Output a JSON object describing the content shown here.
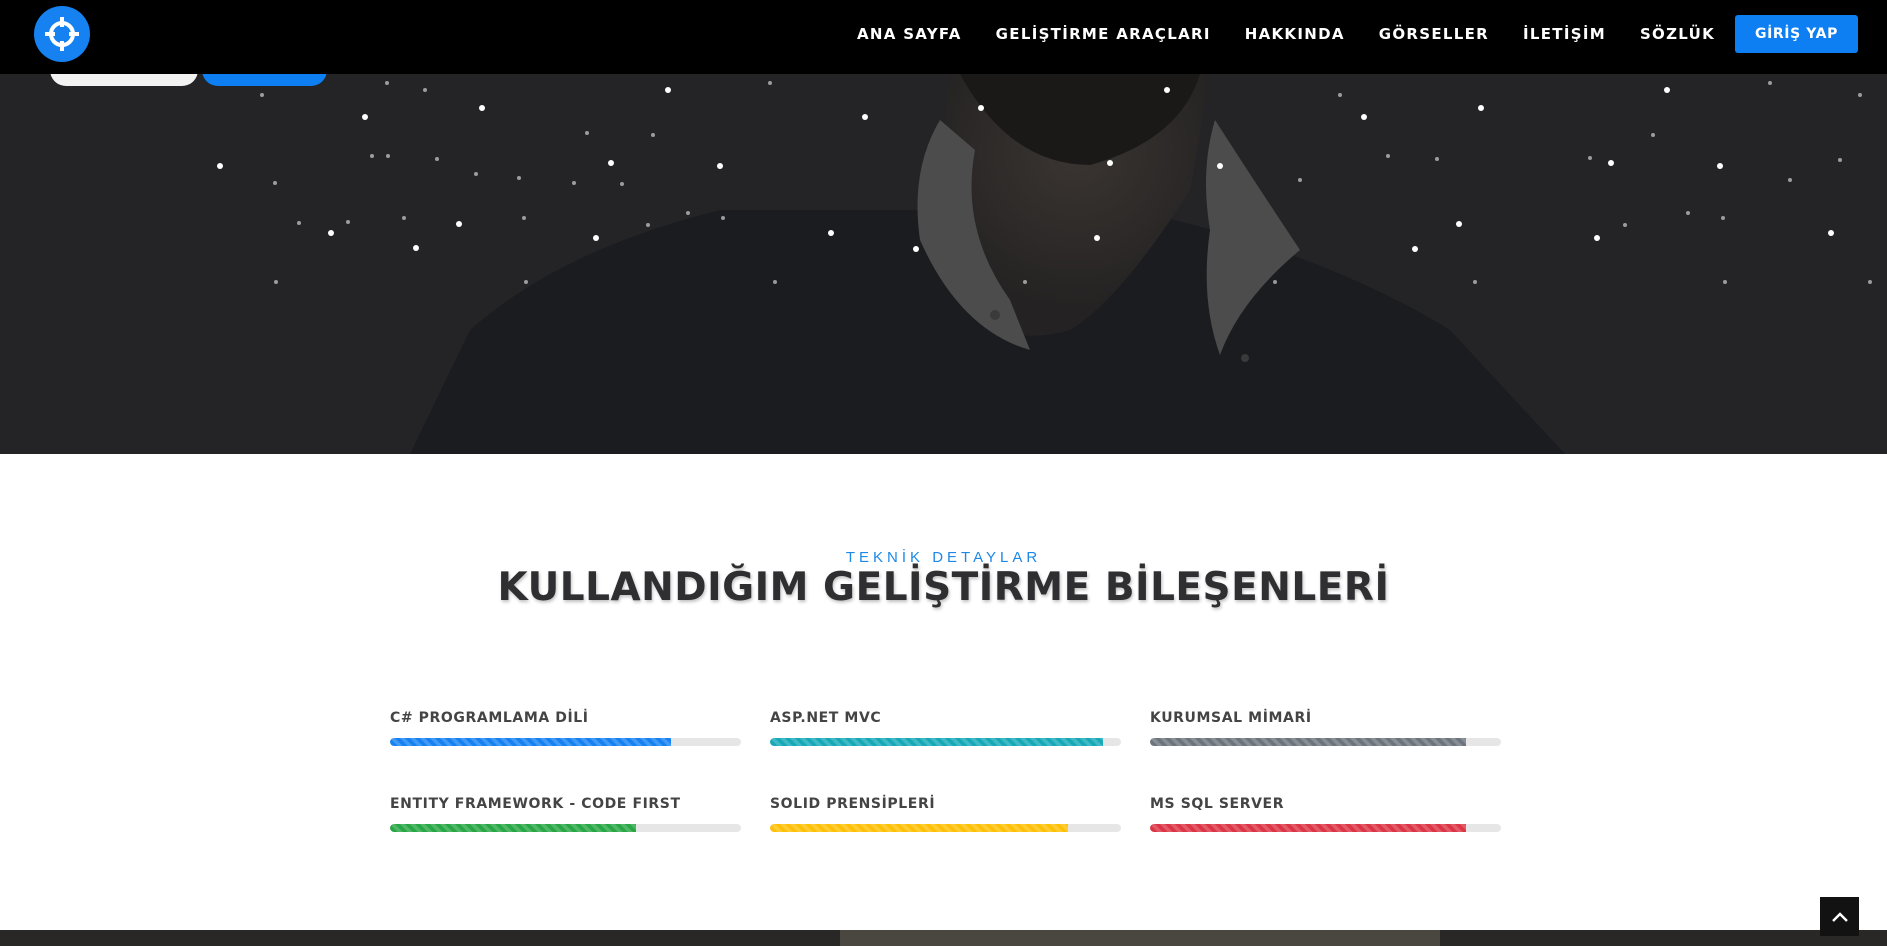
{
  "navbar": {
    "logo_icon": "crosshair-icon",
    "links": [
      {
        "label": "ANA SAYFA"
      },
      {
        "label": "GELİŞTİRME ARAÇLARI"
      },
      {
        "label": "HAKKINDA"
      },
      {
        "label": "GÖRSELLER"
      },
      {
        "label": "İLETİŞİM"
      },
      {
        "label": "SÖZLÜK"
      }
    ],
    "login_label": "GİRİŞ YAP",
    "accent_color": "#0d7ff2"
  },
  "skills_section": {
    "subtitle": "TEKNİK DETAYLAR",
    "title": "KULLANDIĞIM GELİŞTİRME BİLEŞENLERİ",
    "skills": [
      {
        "label": "C# PROGRAMLAMA DİLİ",
        "percent": 80,
        "color": "#1682f2"
      },
      {
        "label": "ASP.NET MVC",
        "percent": 95,
        "color": "#17a9b8"
      },
      {
        "label": "KURUMSAL MİMARİ",
        "percent": 90,
        "color": "#6c757d"
      },
      {
        "label": "ENTITY FRAMEWORK - CODE FIRST",
        "percent": 70,
        "color": "#28a745"
      },
      {
        "label": "SOLID PRENSİPLERİ",
        "percent": 85,
        "color": "#ffc107"
      },
      {
        "label": "MS SQL SERVER",
        "percent": 90,
        "color": "#dc3545"
      }
    ]
  },
  "scroll_top_icon": "chevron-up-icon"
}
